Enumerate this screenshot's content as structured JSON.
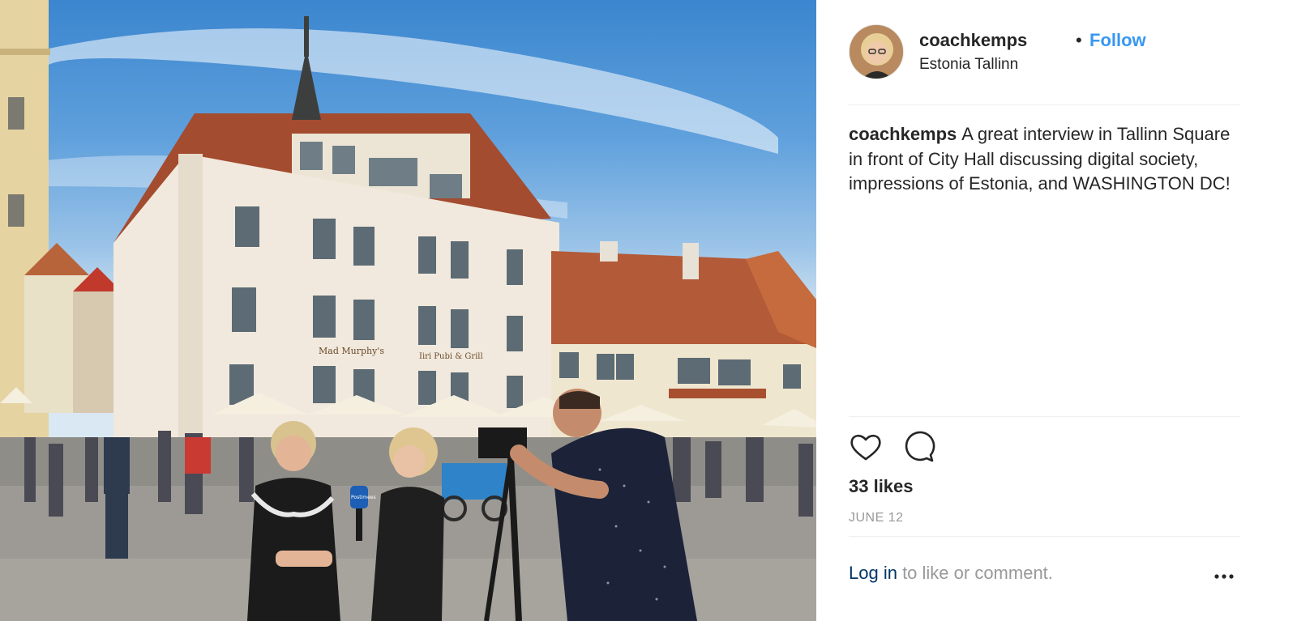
{
  "post": {
    "username": "coachkemps",
    "separator": "•",
    "follow_label": "Follow",
    "location": "Estonia Tallinn",
    "caption_user": "coachkemps",
    "caption_text": "A great interview in Tallinn Square in front of City Hall discussing digital society, impressions of Estonia, and WASHINGTON DC!",
    "likes": "33 likes",
    "date": "JUNE 12"
  },
  "photo": {
    "signs": {
      "left": "Mad Murphy's",
      "right": "Iiri Pubi & Grill"
    },
    "mic_text": "Postimees"
  },
  "footer": {
    "login_link": "Log in",
    "login_suffix": " to like or comment."
  },
  "icons": {
    "like": "heart-icon",
    "comment": "comment-bubble-icon",
    "more": "more-options-icon"
  },
  "colors": {
    "link": "#3897f0",
    "login_link": "#003569",
    "muted": "#999999",
    "text": "#262626"
  }
}
